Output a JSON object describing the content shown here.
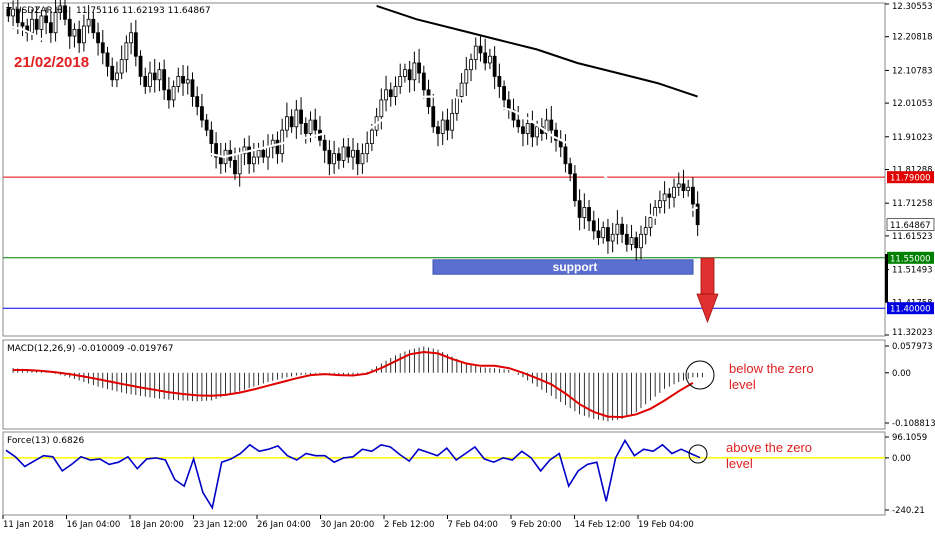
{
  "window": {
    "title": "USDZAR,H4",
    "ohlc_readout": "11.75116 11.62193 11.64867"
  },
  "annotations": {
    "date_label": "21/02/2018",
    "support_label": "support",
    "macd_note": "below the zero level",
    "force_note": "above the zero level"
  },
  "colors": {
    "bearish_candle": "#000000",
    "bullish_candle": "#ffffff",
    "sma_fast": "#ffffff",
    "sma_slow": "#000000",
    "resistance_line": "#e00000",
    "support_line": "#008000",
    "target_line": "#0000e0",
    "support_box": "#5a6fd0",
    "arrow": "#e03030",
    "annotation_text": "#e02020",
    "macd_signal": "#e00000",
    "force_line": "#0000c8",
    "force_zero": "#ffff00"
  },
  "chart_data": [
    {
      "type": "candlestick",
      "symbol": "USDZAR",
      "timeframe": "H4",
      "last_price": 11.64867,
      "ylim": [
        11.32023,
        12.30553
      ],
      "y_ticks": [
        12.30553,
        12.20818,
        12.10783,
        12.01053,
        11.91023,
        11.81288,
        11.71258,
        11.61523,
        11.51493,
        11.41758,
        11.32023
      ],
      "price_labels": [
        {
          "value": 11.79,
          "text": "11.79000",
          "color": "#e00000"
        },
        {
          "value": 11.64867,
          "text": "11.64867",
          "color": "#ffffff"
        },
        {
          "value": 11.55,
          "text": "11.55000",
          "color": "#008000"
        },
        {
          "value": 11.4,
          "text": "11.40000",
          "color": "#0000e0"
        }
      ],
      "horizontal_lines": [
        {
          "value": 11.79,
          "color": "#e00000"
        },
        {
          "value": 11.55,
          "color": "#008000"
        },
        {
          "value": 11.4,
          "color": "#0000e0"
        }
      ],
      "support_zone": {
        "from": 11.525,
        "to": 11.55,
        "label": "support"
      },
      "close_series": [
        12.27,
        12.29,
        12.25,
        12.24,
        12.22,
        12.26,
        12.23,
        12.27,
        12.25,
        12.22,
        12.28,
        12.3,
        12.26,
        12.21,
        12.23,
        12.19,
        12.24,
        12.26,
        12.22,
        12.19,
        12.16,
        12.12,
        12.08,
        12.1,
        12.14,
        12.19,
        12.22,
        12.15,
        12.09,
        12.06,
        12.1,
        12.08,
        12.11,
        12.05,
        12.02,
        12.06,
        12.09,
        12.07,
        12.08,
        12.03,
        12.0,
        11.96,
        11.93,
        11.89,
        11.85,
        11.83,
        11.87,
        11.84,
        11.8,
        11.86,
        11.88,
        11.83,
        11.85,
        11.87,
        11.85,
        11.88,
        11.9,
        11.86,
        11.93,
        11.97,
        11.94,
        11.99,
        11.95,
        11.92,
        11.96,
        11.93,
        11.9,
        11.87,
        11.83,
        11.86,
        11.84,
        11.88,
        11.85,
        11.87,
        11.83,
        11.86,
        11.89,
        11.93,
        11.97,
        12.02,
        12.05,
        12.03,
        12.06,
        12.09,
        12.11,
        12.08,
        12.13,
        12.1,
        12.05,
        12.0,
        11.94,
        11.92,
        11.96,
        11.93,
        11.98,
        12.03,
        12.07,
        12.11,
        12.14,
        12.18,
        12.16,
        12.13,
        12.15,
        12.09,
        12.06,
        12.02,
        11.99,
        11.96,
        11.94,
        11.92,
        11.95,
        11.91,
        11.94,
        11.92,
        11.96,
        11.93,
        11.9,
        11.88,
        11.83,
        11.8,
        11.72,
        11.67,
        11.7,
        11.66,
        11.63,
        11.61,
        11.64,
        11.6,
        11.62,
        11.65,
        11.62,
        11.59,
        11.61,
        11.58,
        11.62,
        11.64,
        11.67,
        11.7,
        11.72,
        11.74,
        11.73,
        11.76,
        11.77,
        11.75,
        11.76,
        11.71,
        11.64867
      ],
      "sma_fast_series": [
        12.24,
        12.23,
        12.21,
        12.18,
        12.15,
        12.12,
        12.09,
        12.06,
        12.04,
        12.02,
        11.99,
        11.96,
        11.92,
        11.89,
        11.86,
        11.85,
        11.86,
        11.87,
        11.88,
        11.89,
        11.9,
        11.91,
        11.92,
        11.91,
        11.91,
        11.93,
        11.96,
        12.0,
        12.02,
        12.03,
        12.03,
        12.03,
        12.02,
        12.01,
        12.0,
        11.99,
        11.97,
        11.94,
        11.91,
        11.89,
        11.86,
        11.82,
        11.77,
        11.72,
        11.69,
        11.67,
        11.67,
        11.68,
        11.7
      ],
      "sma_slow_series": [
        12.3,
        12.26,
        12.23,
        12.2,
        12.17,
        12.13,
        12.1,
        12.07,
        12.03
      ],
      "sma_slow_start_index": 78,
      "x_labels": [
        "11 Jan 2018",
        "16 Jan 04:00",
        "18 Jan 20:00",
        "23 Jan 12:00",
        "26 Jan 04:00",
        "30 Jan 20:00",
        "2 Feb 12:00",
        "7 Feb 04:00",
        "9 Feb 20:00",
        "14 Feb 12:00",
        "19 Feb 04:00"
      ]
    },
    {
      "type": "bar",
      "title": "MACD(12,26,9) -0.010009 -0.019767",
      "ylim": [
        -0.108813,
        0.057973
      ],
      "y_ticks": [
        0.057973,
        0.0,
        -0.108813
      ],
      "y_tick_labels": [
        "0.057973",
        "0.00",
        "-0.108813"
      ],
      "histogram": [
        0.01,
        0.008,
        0.004,
        -0.002,
        -0.01,
        -0.02,
        -0.03,
        -0.038,
        -0.045,
        -0.05,
        -0.055,
        -0.058,
        -0.06,
        -0.062,
        -0.06,
        -0.05,
        -0.04,
        -0.03,
        -0.02,
        -0.012,
        -0.006,
        -0.003,
        0.0,
        -0.004,
        -0.006,
        0.002,
        0.02,
        0.038,
        0.05,
        0.057,
        0.05,
        0.035,
        0.02,
        0.012,
        0.01,
        0.006,
        -0.01,
        -0.03,
        -0.05,
        -0.07,
        -0.09,
        -0.1,
        -0.105,
        -0.1,
        -0.085,
        -0.06,
        -0.035,
        -0.02,
        -0.01
      ],
      "signal": [
        0.006,
        0.006,
        0.004,
        0.001,
        -0.003,
        -0.008,
        -0.014,
        -0.02,
        -0.026,
        -0.032,
        -0.037,
        -0.042,
        -0.046,
        -0.049,
        -0.05,
        -0.048,
        -0.043,
        -0.036,
        -0.028,
        -0.02,
        -0.012,
        -0.005,
        -0.003,
        -0.005,
        -0.006,
        -0.002,
        0.01,
        0.025,
        0.04,
        0.045,
        0.042,
        0.03,
        0.02,
        0.015,
        0.015,
        0.01,
        0.0,
        -0.012,
        -0.025,
        -0.045,
        -0.068,
        -0.085,
        -0.095,
        -0.096,
        -0.09,
        -0.078,
        -0.06,
        -0.04,
        -0.022
      ],
      "annotation": "below the zero level"
    },
    {
      "type": "line",
      "title": "Force(13) 0.6826",
      "ylim": [
        -240.21,
        96.1059
      ],
      "y_ticks": [
        96.1059,
        0.0,
        -240.21
      ],
      "y_tick_labels": [
        "96.1059",
        "0.00",
        "-240.21"
      ],
      "values": [
        35,
        5,
        -40,
        -15,
        10,
        5,
        -60,
        -30,
        5,
        -10,
        -5,
        -30,
        -20,
        5,
        -50,
        -5,
        0,
        -10,
        -100,
        -130,
        -5,
        -160,
        -230,
        -20,
        -5,
        20,
        60,
        30,
        40,
        55,
        10,
        -10,
        20,
        10,
        10,
        -20,
        0,
        5,
        40,
        30,
        60,
        50,
        15,
        -15,
        40,
        25,
        10,
        45,
        -10,
        20,
        50,
        -5,
        -20,
        0,
        -10,
        30,
        0,
        -60,
        -10,
        20,
        -130,
        -60,
        -30,
        -20,
        -200,
        0,
        80,
        10,
        40,
        30,
        60,
        20,
        40,
        20,
        0.6826
      ],
      "annotation": "above the zero level"
    }
  ]
}
